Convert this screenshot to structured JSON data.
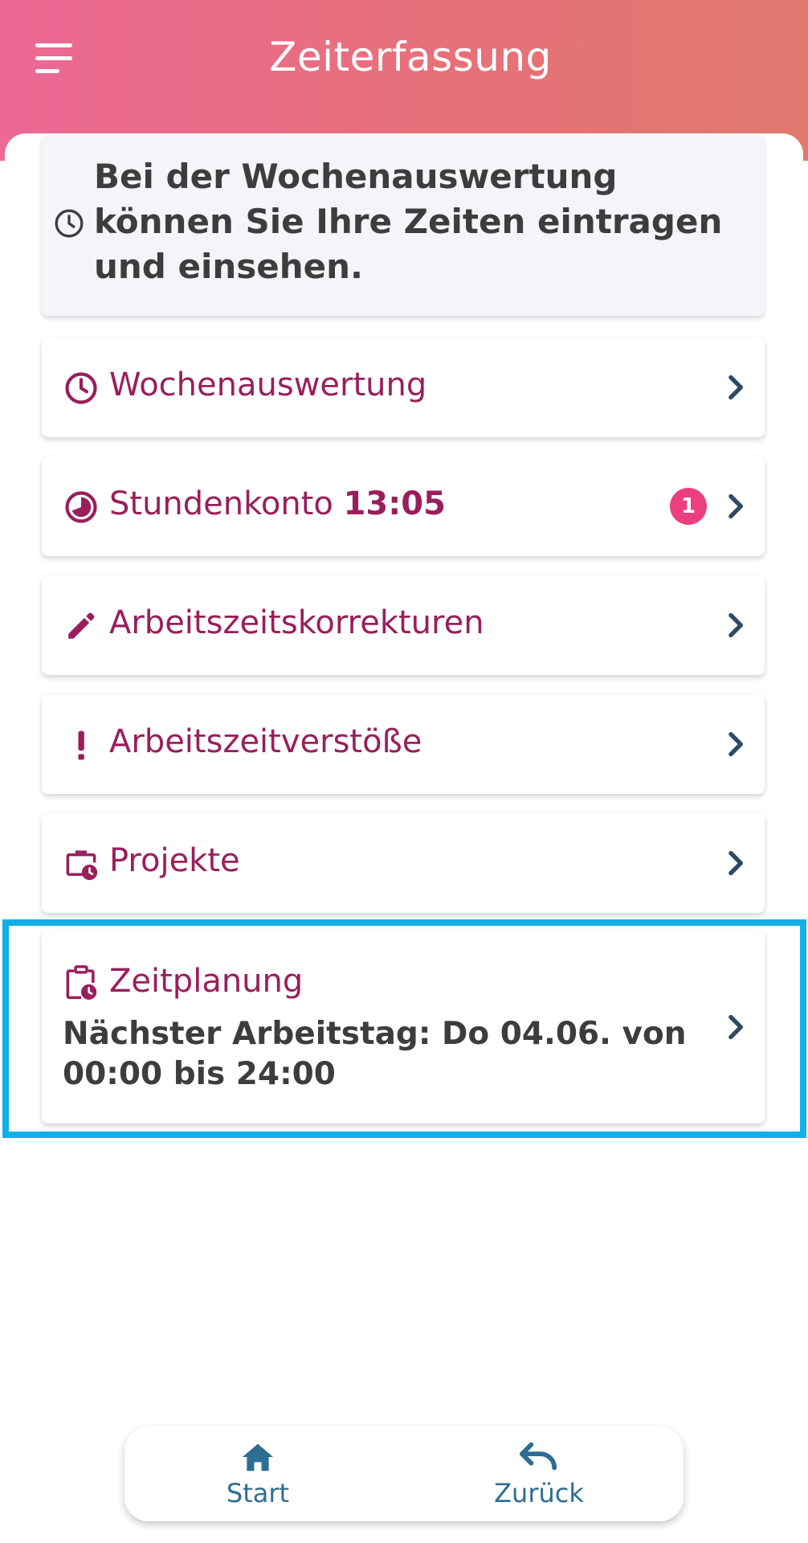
{
  "header": {
    "title": "Zeiterfassung",
    "menu_icon": "hamburger-menu-icon"
  },
  "info": {
    "icon": "clock-icon",
    "text": "Bei der Wochenauswertung können Sie Ihre Zeiten eintragen und einsehen."
  },
  "menu": {
    "items": [
      {
        "icon": "clock-icon",
        "label": "Wochenauswertung"
      },
      {
        "icon": "pie-chart-icon",
        "label": "Stundenkonto",
        "value": "13:05",
        "badge": "1"
      },
      {
        "icon": "pencil-icon",
        "label": "Arbeitszeitskorrekturen"
      },
      {
        "icon": "exclamation-icon",
        "label": "Arbeitszeitverstöße"
      },
      {
        "icon": "briefcase-clock-icon",
        "label": "Projekte"
      }
    ]
  },
  "planning": {
    "icon": "clipboard-clock-icon",
    "label": "Zeitplanung",
    "next_workday": "Nächster Arbeitstag: Do 04.06. von 00:00 bis 24:00"
  },
  "bottom_nav": {
    "start_label": "Start",
    "back_label": "Zurück"
  },
  "colors": {
    "accent": "#9a1e5c",
    "badge": "#ec3f7e",
    "nav": "#2d6e93",
    "highlight": "#12b0e8"
  }
}
